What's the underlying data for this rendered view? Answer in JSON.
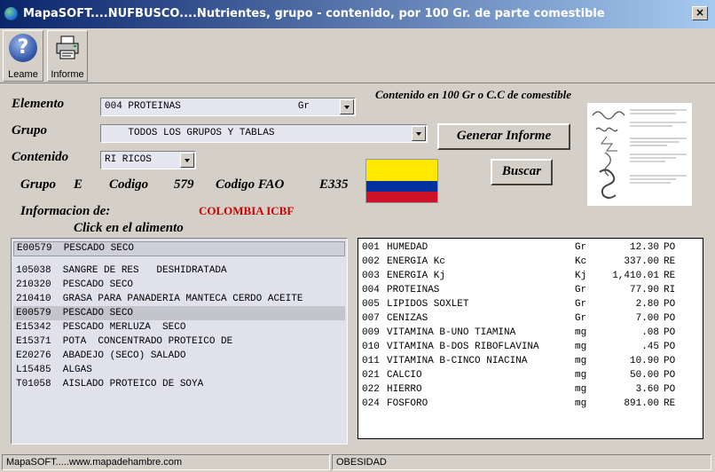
{
  "window": {
    "title": "MapaSOFT....NUFBUSCO....Nutrientes, grupo - contenido, por 100 Gr. de parte comestible",
    "close_label": "×"
  },
  "toolbar": {
    "leame_label": "Leame",
    "informe_label": "Informe"
  },
  "form": {
    "elemento_label": "Elemento",
    "grupo_label": "Grupo",
    "contenido_label": "Contenido",
    "elemento_value": "004 PROTEINAS                    Gr",
    "grupo_value": "    TODOS LOS GRUPOS Y TABLAS",
    "contenido_value": "RI RICOS",
    "generar_label": "Generar Informe",
    "buscar_label": "Buscar",
    "contenido_header": "Contenido en 100 Gr o C.C de comestible"
  },
  "info": {
    "grupo_label": "Grupo",
    "grupo_value": "E",
    "codigo_label": "Codigo",
    "codigo_value": "579",
    "codigo_fao_label": "Codigo FAO",
    "codigo_fao_value": "E335",
    "informacion_label": "Informacion de:",
    "informacion_value": "COLOMBIA ICBF",
    "click_label": "Click en el alimento"
  },
  "colors": {
    "accent_red": "#cc0000"
  },
  "food_list": {
    "selected": "E00579  PESCADO SECO",
    "items": [
      "105038  SANGRE DE RES   DESHIDRATADA",
      "210320  PESCADO SECO",
      "210410  GRASA PARA PANADERIA MANTECA CERDO ACEITE",
      "E00579  PESCADO SECO",
      "E15342  PESCADO MERLUZA  SECO",
      "E15371  POTA  CONCENTRADO PROTEICO DE",
      "E20276  ABADEJO (SECO) SALADO",
      "L15485  ALGAS",
      "T01058  AISLADO PROTEICO DE SOYA"
    ]
  },
  "nutrients": [
    {
      "code": "001",
      "name": "HUMEDAD",
      "unit": "Gr",
      "value": "12.30",
      "flag": "PO"
    },
    {
      "code": "002",
      "name": "ENERGIA Kc",
      "unit": "Kc",
      "value": "337.00",
      "flag": "RE"
    },
    {
      "code": "003",
      "name": "ENERGIA Kj",
      "unit": "Kj",
      "value": "1,410.01",
      "flag": "RE"
    },
    {
      "code": "004",
      "name": "PROTEINAS",
      "unit": "Gr",
      "value": "77.90",
      "flag": "RI"
    },
    {
      "code": "005",
      "name": "LIPIDOS SOXLET",
      "unit": "Gr",
      "value": "2.80",
      "flag": "PO"
    },
    {
      "code": "007",
      "name": "CENIZAS",
      "unit": "Gr",
      "value": "7.00",
      "flag": "PO"
    },
    {
      "code": "009",
      "name": "VITAMINA B-UNO TIAMINA",
      "unit": "mg",
      "value": ".08",
      "flag": "PO"
    },
    {
      "code": "010",
      "name": "VITAMINA B-DOS RIBOFLAVINA",
      "unit": "mg",
      "value": ".45",
      "flag": "PO"
    },
    {
      "code": "011",
      "name": "VITAMINA B-CINCO NIACINA",
      "unit": "mg",
      "value": "10.90",
      "flag": "PO"
    },
    {
      "code": "021",
      "name": "CALCIO",
      "unit": "mg",
      "value": "50.00",
      "flag": "PO"
    },
    {
      "code": "022",
      "name": "HIERRO",
      "unit": "mg",
      "value": "3.60",
      "flag": "PO"
    },
    {
      "code": "024",
      "name": "FOSFORO",
      "unit": "mg",
      "value": "891.00",
      "flag": "RE"
    }
  ],
  "status": {
    "left": "MapaSOFT.....www.mapadehambre.com",
    "middle": "OBESIDAD"
  }
}
